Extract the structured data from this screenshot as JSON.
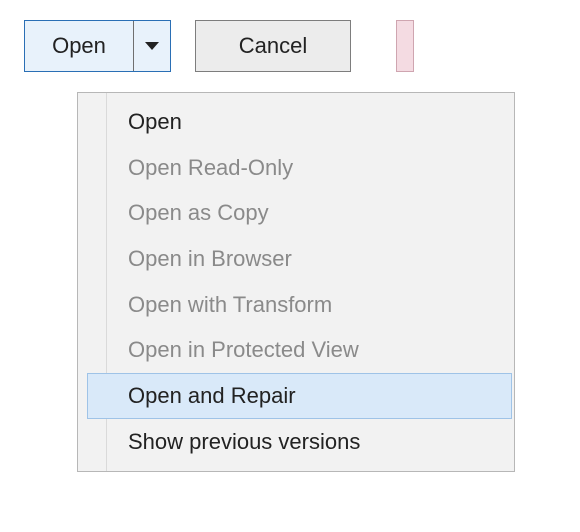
{
  "buttons": {
    "open_label": "Open",
    "cancel_label": "Cancel"
  },
  "dropdown": {
    "items": [
      {
        "label": "Open",
        "enabled": true,
        "selected": false
      },
      {
        "label": "Open Read-Only",
        "enabled": false,
        "selected": false
      },
      {
        "label": "Open as Copy",
        "enabled": false,
        "selected": false
      },
      {
        "label": "Open in Browser",
        "enabled": false,
        "selected": false
      },
      {
        "label": "Open with Transform",
        "enabled": false,
        "selected": false
      },
      {
        "label": "Open in Protected View",
        "enabled": false,
        "selected": false
      },
      {
        "label": "Open and Repair",
        "enabled": true,
        "selected": true
      },
      {
        "label": "Show previous versions",
        "enabled": true,
        "selected": false
      }
    ]
  },
  "colors": {
    "highlight_bg": "#d9e9f9",
    "highlight_border": "#9fc3e7",
    "disabled_text": "#8a8a8a",
    "button_border_active": "#2a6fb5",
    "pink_accent": "#f4dbe2"
  }
}
